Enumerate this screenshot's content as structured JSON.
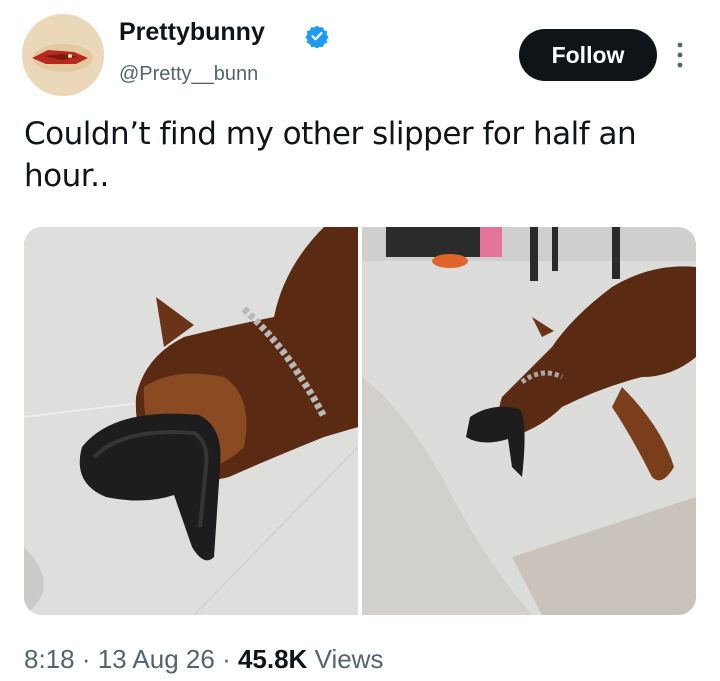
{
  "author": {
    "display_name": "Prettybunny",
    "handle": "@Pretty__bunn",
    "verified": true
  },
  "actions": {
    "follow_label": "Follow"
  },
  "tweet": {
    "text": "Couldn’t find my other slipper for half an hour.."
  },
  "media": {
    "photos": [
      {
        "alt": ""
      },
      {
        "alt": ""
      }
    ]
  },
  "meta": {
    "time": "8:18",
    "separator1": " · ",
    "date": "13 Aug 26",
    "separator2": " · ",
    "views_count": "45.8K",
    "views_label": " Views"
  },
  "colors": {
    "text_primary": "#0f1419",
    "text_secondary": "#536471",
    "verified_blue": "#1d9bf0",
    "follow_bg": "#0f1419"
  },
  "icons": {
    "verified": "verified-badge-icon",
    "more": "more-options-icon"
  }
}
